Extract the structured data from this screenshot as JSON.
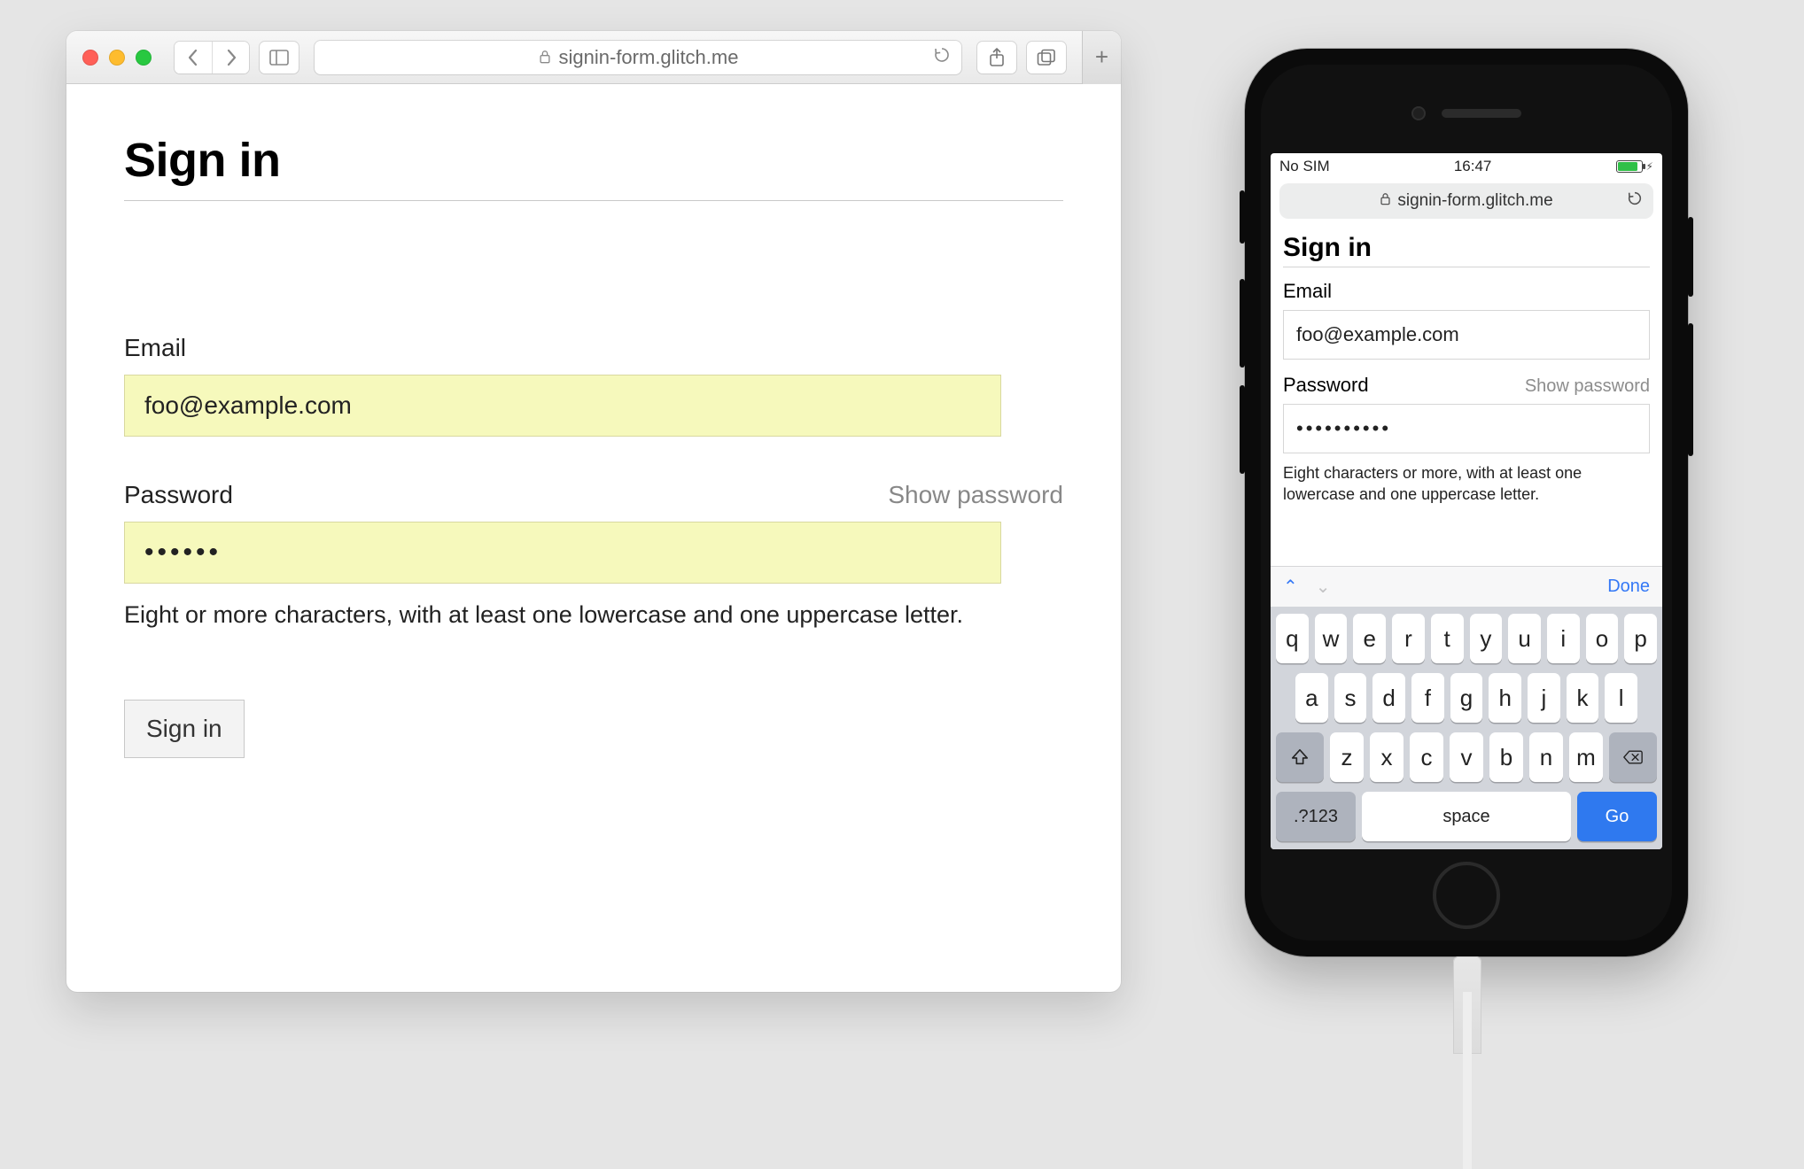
{
  "desktop": {
    "url_host": "signin-form.glitch.me",
    "page": {
      "title": "Sign in",
      "email_label": "Email",
      "email_value": "foo@example.com",
      "password_label": "Password",
      "show_password": "Show password",
      "password_value": "••••••",
      "password_hint": "Eight or more characters, with at least one lowercase and one uppercase letter.",
      "submit_label": "Sign in"
    }
  },
  "phone": {
    "status": {
      "carrier": "No SIM",
      "time": "16:47"
    },
    "url_host": "signin-form.glitch.me",
    "page": {
      "title": "Sign in",
      "email_label": "Email",
      "email_value": "foo@example.com",
      "password_label": "Password",
      "show_password": "Show password",
      "password_value": "••••••••••",
      "password_hint": "Eight characters or more, with at least one lowercase and one uppercase letter."
    },
    "keyboard": {
      "done": "Done",
      "rows": [
        [
          "q",
          "w",
          "e",
          "r",
          "t",
          "y",
          "u",
          "i",
          "o",
          "p"
        ],
        [
          "a",
          "s",
          "d",
          "f",
          "g",
          "h",
          "j",
          "k",
          "l"
        ],
        [
          "z",
          "x",
          "c",
          "v",
          "b",
          "n",
          "m"
        ]
      ],
      "num_key": ".?123",
      "space_key": "space",
      "go_key": "Go"
    }
  }
}
